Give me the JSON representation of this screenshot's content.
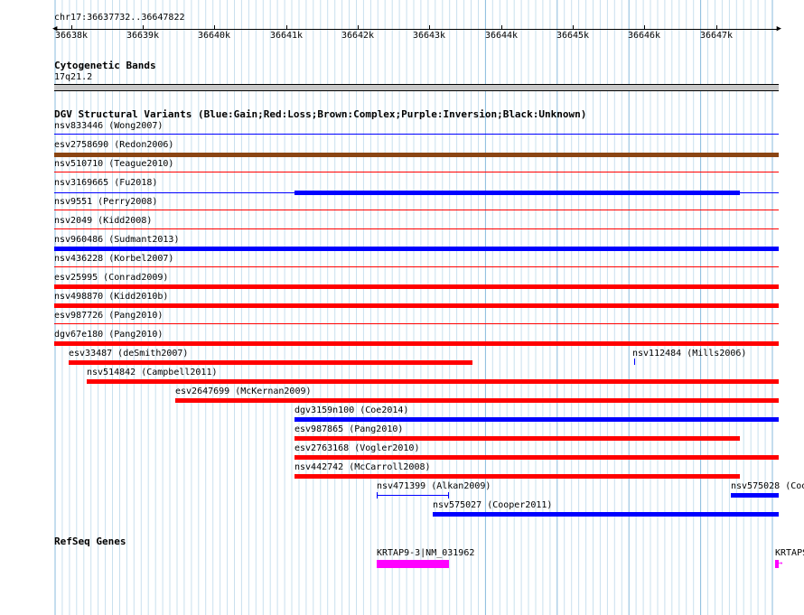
{
  "position_label": "chr17:36637732..36647822",
  "ruler_ticks": [
    "36638k",
    "36639k",
    "36640k",
    "36641k",
    "36642k",
    "36643k",
    "36644k",
    "36645k",
    "36646k",
    "36647k"
  ],
  "cytoband": {
    "title": "Cytogenetic Bands",
    "band": "17q21.2"
  },
  "dgv": {
    "title": "DGV Structural Variants (Blue:Gain;Red:Loss;Brown:Complex;Purple:Inversion;Black:Unknown)",
    "colors": {
      "gain": "#0000ff",
      "loss": "#ff0000",
      "complex": "#8b4513",
      "inversion": "#800080",
      "unknown": "#000000"
    },
    "features": [
      {
        "label": "nsv833446 (Wong2007)",
        "type": "gain"
      },
      {
        "label": "esv2758690 (Redon2006)",
        "type": "complex"
      },
      {
        "label": "nsv510710 (Teague2010)",
        "type": "loss"
      },
      {
        "label": "nsv3169665 (Fu2018)",
        "type": "gain"
      },
      {
        "label": "nsv9551 (Perry2008)",
        "type": "loss"
      },
      {
        "label": "nsv2049 (Kidd2008)",
        "type": "loss"
      },
      {
        "label": "nsv960486 (Sudmant2013)",
        "type": "gain"
      },
      {
        "label": "nsv436228 (Korbel2007)",
        "type": "loss"
      },
      {
        "label": "esv25995 (Conrad2009)",
        "type": "loss"
      },
      {
        "label": "nsv498870 (Kidd2010b)",
        "type": "loss"
      },
      {
        "label": "esv987726 (Pang2010)",
        "type": "loss"
      },
      {
        "label": "dgv67e180 (Pang2010)",
        "type": "loss"
      },
      {
        "label": "esv33487 (deSmith2007)",
        "type": "loss"
      },
      {
        "label": "nsv112484 (Mills2006)",
        "type": "gain"
      },
      {
        "label": "nsv514842 (Campbell2011)",
        "type": "loss"
      },
      {
        "label": "esv2647699 (McKernan2009)",
        "type": "loss"
      },
      {
        "label": "dgv3159n100 (Coe2014)",
        "type": "gain"
      },
      {
        "label": "esv987865 (Pang2010)",
        "type": "loss"
      },
      {
        "label": "esv2763168 (Vogler2010)",
        "type": "loss"
      },
      {
        "label": "nsv442742 (McCarroll2008)",
        "type": "loss"
      },
      {
        "label": "nsv471399 (Alkan2009)",
        "type": "gain"
      },
      {
        "label": "nsv575028 (Coo",
        "type": "gain"
      },
      {
        "label": "nsv575027 (Cooper2011)",
        "type": "gain"
      }
    ]
  },
  "refseq": {
    "title": "RefSeq Genes",
    "genes": [
      {
        "label": "KRTAP9-3|NM_031962",
        "color": "#ff00ff"
      },
      {
        "label": "KRTAPS",
        "color": "#ff00ff"
      }
    ]
  }
}
